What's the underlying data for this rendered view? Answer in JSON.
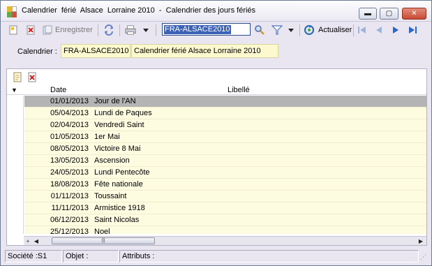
{
  "window": {
    "title": "Calendrier  férié  Alsace  Lorraine 2010  -  Calendrier des jours fériés",
    "close_glyph": "✕",
    "min_glyph": "▬",
    "max_glyph": "▢"
  },
  "toolbar": {
    "save_label": "Enregistrer",
    "code_value": "FRA-ALSACE2010",
    "refresh_label": "Actualiser",
    "icons": [
      "new-doc-icon",
      "delete-icon",
      "save-icon",
      "sync-icon",
      "print-icon",
      "dropdown-icon",
      "search-icon",
      "filter-icon",
      "refresh-icon",
      "first-icon",
      "prev-icon",
      "next-icon",
      "last-icon"
    ],
    "accent": "#3b62b6"
  },
  "calendar": {
    "label": "Calendrier :",
    "code": "FRA-ALSACE2010",
    "name": "Calendrier  férié  Alsace  Lorraine 2010"
  },
  "grid": {
    "columns": [
      "Date",
      "Libellé"
    ],
    "rows": [
      {
        "date": "01/01/2013",
        "label": "Jour  de  l'AN"
      },
      {
        "date": "05/04/2013",
        "label": "Lundi de Paques"
      },
      {
        "date": "02/04/2013",
        "label": "Vendredi  Saint"
      },
      {
        "date": "01/05/2013",
        "label": "1er Mai"
      },
      {
        "date": "08/05/2013",
        "label": "Victoire 8 Mai"
      },
      {
        "date": "13/05/2013",
        "label": "Ascension"
      },
      {
        "date": "24/05/2013",
        "label": "Lundi Pentecôte"
      },
      {
        "date": "18/08/2013",
        "label": "Fête  nationale"
      },
      {
        "date": "01/11/2013",
        "label": "Toussaint"
      },
      {
        "date": "11/11/2013",
        "label": "Armistice 1918"
      },
      {
        "date": "06/12/2013",
        "label": "Saint Nicolas"
      },
      {
        "date": "25/12/2013",
        "label": "Noel"
      }
    ],
    "selected_index": 0,
    "row_color": "#fdfbe0",
    "selected_color": "#b4b4b4"
  },
  "statusbar": {
    "societe": "Société :S1",
    "objet": "Objet :",
    "attributs": "Attributs :"
  }
}
